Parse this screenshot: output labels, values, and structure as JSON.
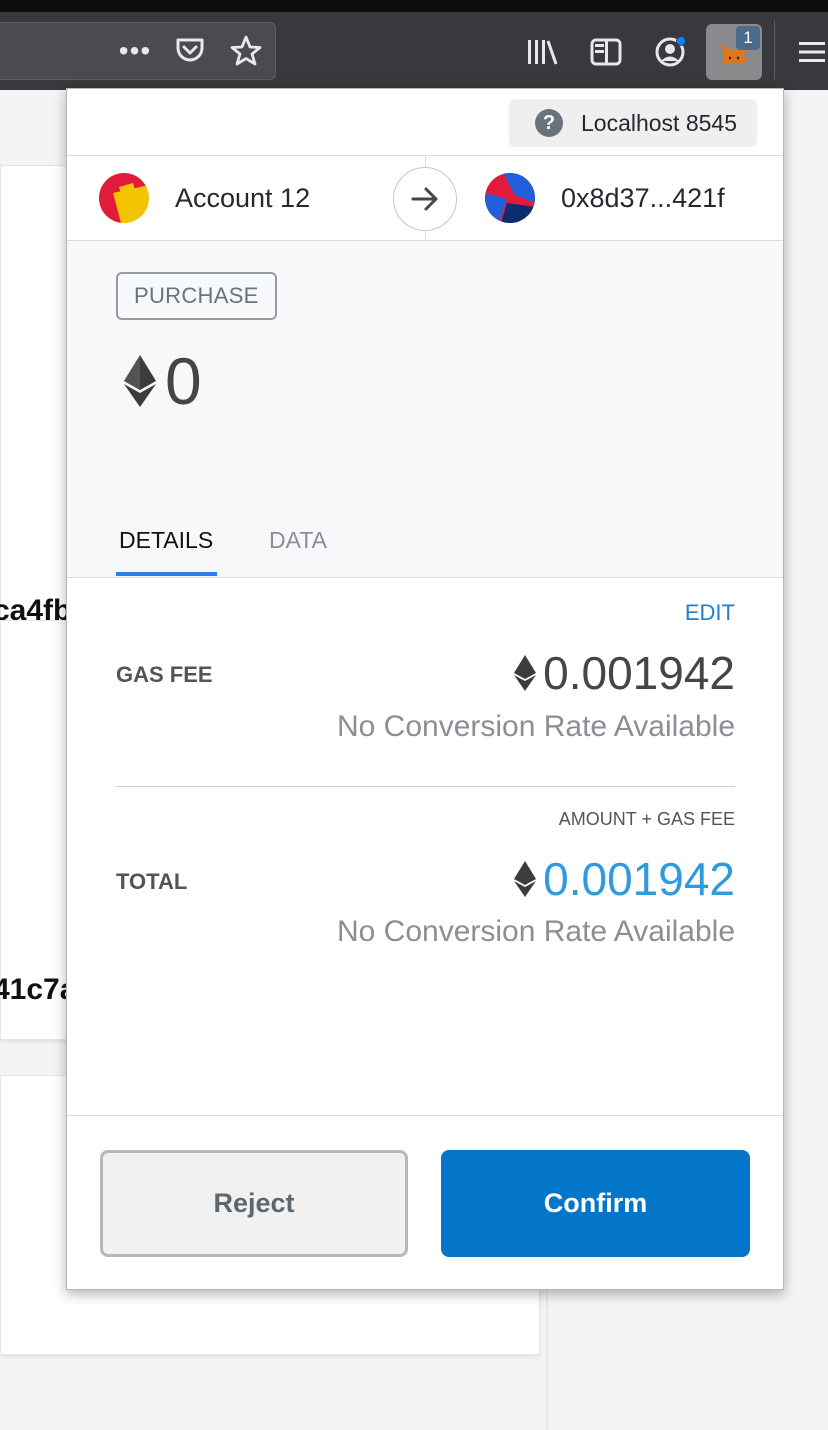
{
  "browser": {
    "extension_badge": "1"
  },
  "background_page": {
    "row1_text": "ca4fb",
    "row2_text": "41c7a"
  },
  "popup": {
    "network": "Localhost 8545",
    "from_account": "Account 12",
    "to_address": "0x8d37...421f",
    "action_badge": "PURCHASE",
    "amount": "0",
    "tabs": [
      "DETAILS",
      "DATA"
    ],
    "active_tab": "DETAILS",
    "edit_label": "EDIT",
    "gas_fee": {
      "label": "GAS FEE",
      "value": "0.001942",
      "conversion": "No Conversion Rate Available"
    },
    "total": {
      "label": "TOTAL",
      "sublabel": "AMOUNT + GAS FEE",
      "value": "0.001942",
      "conversion": "No Conversion Rate Available"
    },
    "buttons": {
      "reject": "Reject",
      "confirm": "Confirm"
    }
  },
  "colors": {
    "confirm_button": "#0376c9",
    "total_value": "#2f9ae0",
    "tab_underline": "#2f80ed",
    "edit_link": "#1e7fd0"
  },
  "icons": [
    "overflow-menu-icon",
    "pocket-icon",
    "bookmark-star-icon",
    "library-icon",
    "sidebar-icon",
    "account-icon",
    "metamask-fox-icon",
    "hamburger-menu-icon",
    "help-icon",
    "arrow-right-icon",
    "ethereum-icon"
  ]
}
